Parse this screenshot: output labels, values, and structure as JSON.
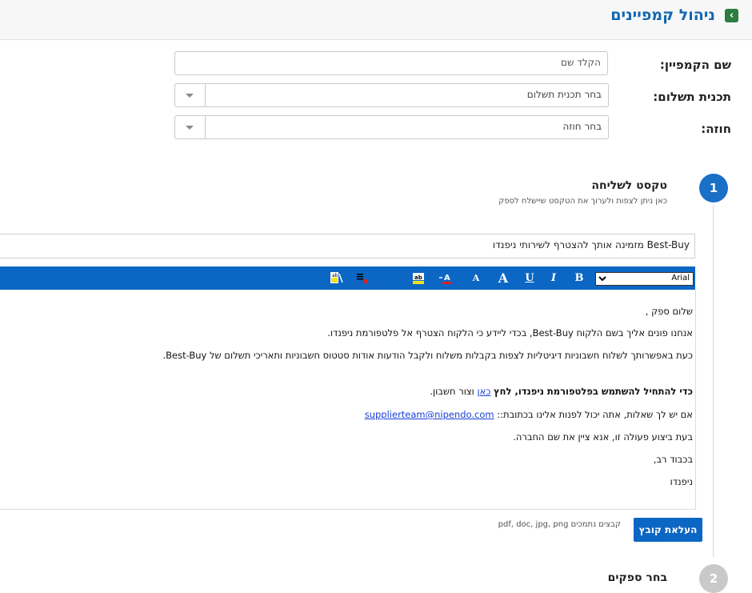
{
  "header": {
    "title": "ניהול קמפיינים",
    "back_icon": "chevron-left-icon"
  },
  "form": {
    "name_label": "שם הקמפיין:",
    "name_placeholder": "הקלד שם",
    "payment_label": "תכנית תשלום:",
    "payment_value": "בחר תכנית תשלום",
    "contract_label": "חוזה:",
    "contract_value": "בחר חוזה"
  },
  "step1": {
    "number": "1",
    "title": "טקסט לשליחה",
    "subtitle": "כאן ניתן לצפות ולערוך את הטקסט שיישלח לספק",
    "subject": "Best-Buy מזמינה אותך להצטרף לשירותי ניפנדו"
  },
  "toolbar": {
    "font": "Arial",
    "bold": "B",
    "italic": "I",
    "underline": "U",
    "font_size_up": "A",
    "font_size_down": "A",
    "add_link": "הוסף קישור לרישום",
    "accent_color": "#0b66c4"
  },
  "editor": {
    "greeting": "שלום ספק ,",
    "line1": "אנחנו פונים אליך בשם הלקוח Best-Buy, בכדי ליידע כי הלקוח הצטרף אל פלטפורמת ניפנדו.",
    "line2": "כעת באפשרותך לשלוח חשבוניות דיגיטליות לצפות בקבלות  משלוח ולקבל הודעות אודות  סטטוס חשבוניות ותאריכי תשלום  של Best-Buy.",
    "cta_bold": "כדי להתחיל להשתמש בפלטפורמת ניפנדו, לחץ",
    "cta_link": "כאן",
    "cta_rest": "וצור חשבון.",
    "questions": "אם יש לך שאלות, אתה יכול לפנות אלינו בכתובת::",
    "email": "supplierteam@nipendo.com",
    "company_note": "בעת ביצוע פעולה זו, אנא ציין את שם החברה.",
    "regards": "בכבוד רב,",
    "signature": "ניפנדו"
  },
  "upload": {
    "button": "העלאת קובץ",
    "note": "קבצים נתמכים pdf, doc, jpg, png"
  },
  "step2": {
    "number": "2",
    "title": "בחר ספקים"
  }
}
